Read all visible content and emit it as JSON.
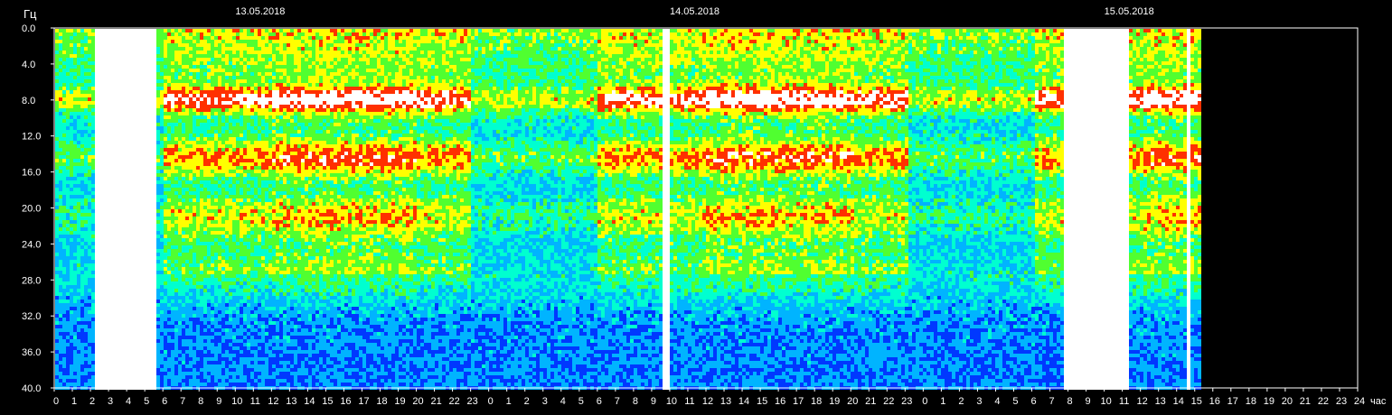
{
  "chart_data": {
    "type": "heatmap",
    "title": "",
    "ylabel": "Гц",
    "xlabel": "час",
    "ylim": [
      0,
      40
    ],
    "y_ticks": [
      "0.0",
      "4.0",
      "8.0",
      "12.0",
      "16.0",
      "20.0",
      "24.0",
      "28.0",
      "32.0",
      "36.0",
      "40.0"
    ],
    "x_ticks": [
      "0",
      "1",
      "2",
      "3",
      "4",
      "5",
      "6",
      "7",
      "8",
      "9",
      "10",
      "11",
      "12",
      "13",
      "14",
      "15",
      "16",
      "17",
      "18",
      "19",
      "20",
      "21",
      "22",
      "23",
      "0",
      "1",
      "2",
      "3",
      "4",
      "5",
      "6",
      "7",
      "8",
      "9",
      "10",
      "11",
      "12",
      "13",
      "14",
      "15",
      "16",
      "17",
      "18",
      "19",
      "20",
      "21",
      "22",
      "23",
      "0",
      "1",
      "2",
      "3",
      "4",
      "5",
      "6",
      "7",
      "8",
      "9",
      "10",
      "11",
      "12",
      "13",
      "14",
      "15",
      "16",
      "17",
      "18",
      "19",
      "20",
      "21",
      "22",
      "23",
      "24"
    ],
    "dates": [
      {
        "label": "13.05.2018",
        "hour": 12
      },
      {
        "label": "14.05.2018",
        "hour": 36
      },
      {
        "label": "15.05.2018",
        "hour": 60
      }
    ],
    "data_end_hour": 63.3,
    "resonance_bands_hz": [
      7.8,
      14.3,
      20.8,
      27.3
    ],
    "bursts": [
      {
        "start": 2.1,
        "end": 5.6
      },
      {
        "start": 33.6,
        "end": 33.9
      },
      {
        "start": 55.7,
        "end": 59.2
      },
      {
        "start": 62.4,
        "end": 62.7
      }
    ],
    "colormap": [
      "#0010c0",
      "#0038ff",
      "#00b4ff",
      "#00ffd0",
      "#50ff30",
      "#ffff00",
      "#ff3000",
      "#ffffff"
    ],
    "grid": false,
    "legend": "none"
  }
}
